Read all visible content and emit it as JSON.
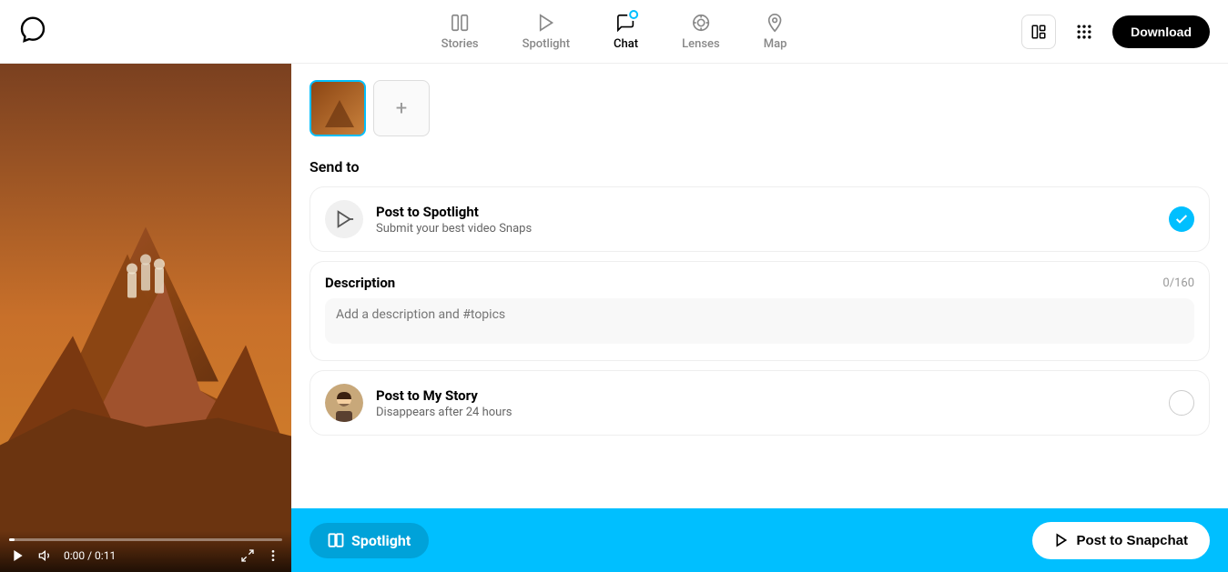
{
  "nav": {
    "logo_label": "Snapchat Logo",
    "items": [
      {
        "id": "stories",
        "label": "Stories",
        "icon": "stories-icon"
      },
      {
        "id": "spotlight",
        "label": "Spotlight",
        "icon": "spotlight-icon"
      },
      {
        "id": "chat",
        "label": "Chat",
        "icon": "chat-icon",
        "badge": true
      },
      {
        "id": "lenses",
        "label": "Lenses",
        "icon": "lenses-icon"
      },
      {
        "id": "map",
        "label": "Map",
        "icon": "map-icon"
      }
    ],
    "download_label": "Download"
  },
  "right_panel": {
    "send_to_label": "Send to",
    "post_spotlight": {
      "title": "Post to Spotlight",
      "subtitle": "Submit your best video Snaps",
      "checked": true
    },
    "description": {
      "label": "Description",
      "count": "0/160",
      "placeholder": "Add a description and #topics"
    },
    "post_story": {
      "title": "Post to My Story",
      "subtitle": "Disappears after 24 hours",
      "checked": false
    }
  },
  "video": {
    "time": "0:00 / 0:11"
  },
  "submit_bar": {
    "spotlight_label": "Spotlight",
    "post_label": "Post to Snapchat"
  },
  "thumb_add_label": "+",
  "colors": {
    "snapchat_blue": "#00bfff",
    "checked_bg": "#00bfff",
    "unchecked_border": "#ccc"
  }
}
